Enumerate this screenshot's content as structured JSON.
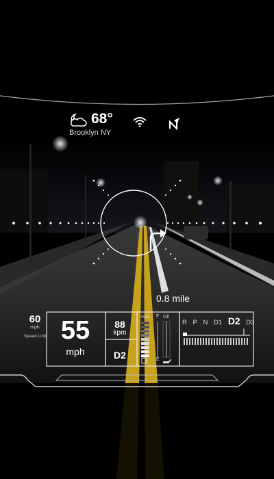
{
  "weather": {
    "icon": "moon-cloud-icon",
    "temperature": "68°",
    "city": "Brooklyn NY"
  },
  "status_icons": [
    "wifi-icon",
    "navigation-arrow-icon"
  ],
  "navigation": {
    "distance": "0.8 mile",
    "turn_icon": "turn-right-arrow-icon"
  },
  "speed_limit": {
    "value": "60",
    "unit": "mph",
    "label": "Speed Limit"
  },
  "speed": {
    "value": "55",
    "unit": "mph"
  },
  "speed_kpm": {
    "value": "88",
    "unit": "kpm"
  },
  "current_gear": "D2",
  "gauges": {
    "gas_label": "Gas",
    "oil_label": "Oil",
    "full_mark": "F",
    "empty_mark": "E",
    "gas_level": 0.55
  },
  "transmission": {
    "gears": [
      "R",
      "P",
      "N",
      "D1",
      "D2",
      "D3"
    ],
    "active": "D2"
  },
  "colors": {
    "hud": "#ffffff",
    "road_line": "#d8b020",
    "background": "#000000"
  }
}
